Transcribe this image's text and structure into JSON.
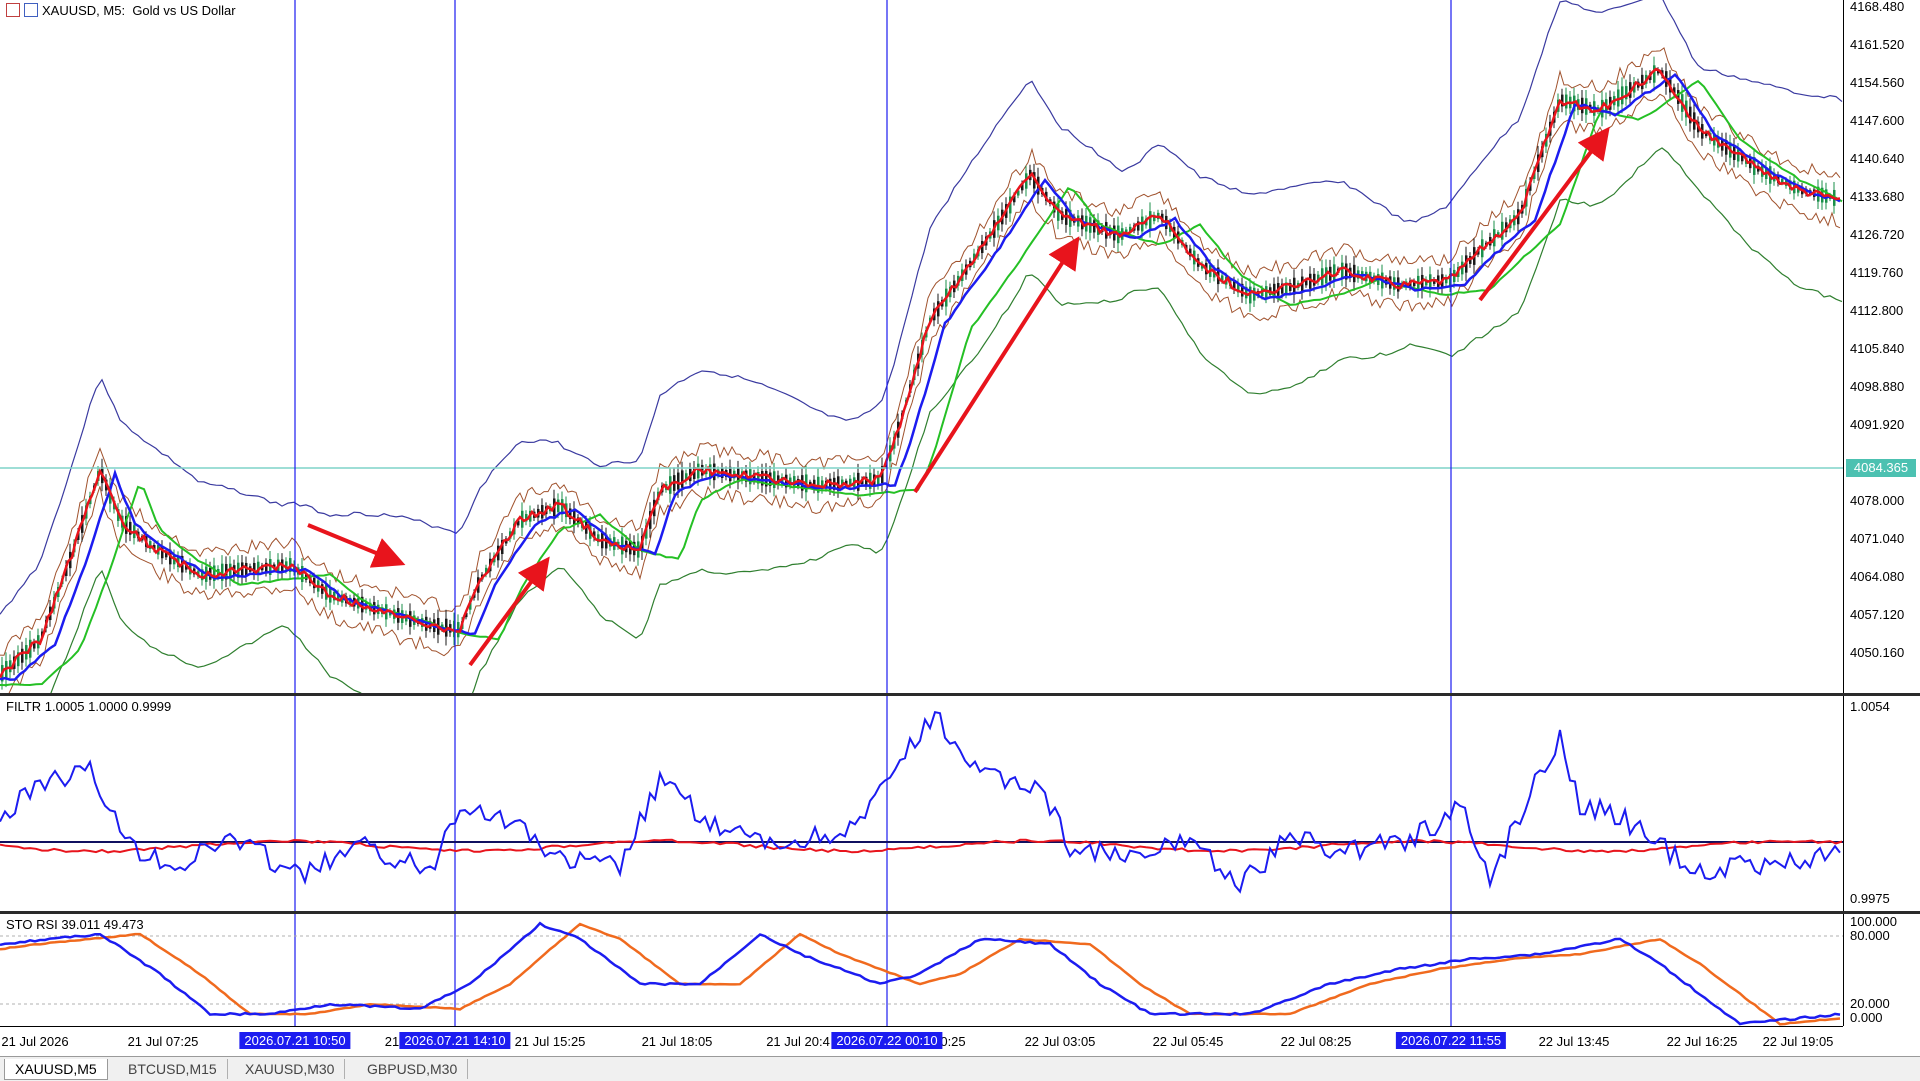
{
  "main_chart": {
    "title_symbol": "XAUUSD, M5:",
    "title_desc": "Gold vs US Dollar",
    "current_price": "4084.365",
    "price_ticks": [
      "4168.480",
      "4161.520",
      "4154.560",
      "4147.600",
      "4140.640",
      "4133.680",
      "4126.720",
      "4119.760",
      "4112.800",
      "4105.840",
      "4098.880",
      "4091.920",
      "4078.000",
      "4071.040",
      "4064.080",
      "4057.120",
      "4050.160"
    ]
  },
  "filtr_pane": {
    "label": "FILTR 1.0005 1.0000 0.9999",
    "scale_top": "1.0054",
    "scale_bottom": "0.9975"
  },
  "rsi_pane": {
    "label": "STO RSI 39.011 49.473",
    "scale": [
      "100.000",
      "80.000",
      "20.000",
      "0.000"
    ]
  },
  "time_axis": {
    "labels": [
      "21 Jul 2026",
      "21 Jul 07:25",
      "21",
      "21 Jul 15:25",
      "21 Jul 18:05",
      "21 Jul 20:4",
      "0:25",
      "22 Jul 03:05",
      "22 Jul 05:45",
      "22 Jul 08:25",
      "22 Jul 13:45",
      "22 Jul 16:25",
      "22 Jul 19:05"
    ],
    "markers": [
      "2026.07.21 10:50",
      "2026.07.21 14:10",
      "2026.07.22 00:10",
      "2026.07.22 11:55"
    ]
  },
  "tabs": [
    {
      "label": "XAUUSD,M5",
      "active": true
    },
    {
      "label": "BTCUSD,M15",
      "active": false
    },
    {
      "label": "XAUUSD,M30",
      "active": false
    },
    {
      "label": "GBPUSD,M30",
      "active": false
    }
  ],
  "colors": {
    "fast_ma": "#e8141c",
    "mid_ma": "#1c1cf0",
    "slow_ma": "#25c025",
    "bollinger_upper": "#3a3aa0",
    "bollinger_lower": "#2f7f2f",
    "envelope": "#a0522d",
    "current_price_line": "#7fd3c8",
    "session_lines": "#1c1cf0",
    "arrows": "#e8141c",
    "sto_k": "#1c1cf0",
    "sto_d": "#f06a1e"
  }
}
